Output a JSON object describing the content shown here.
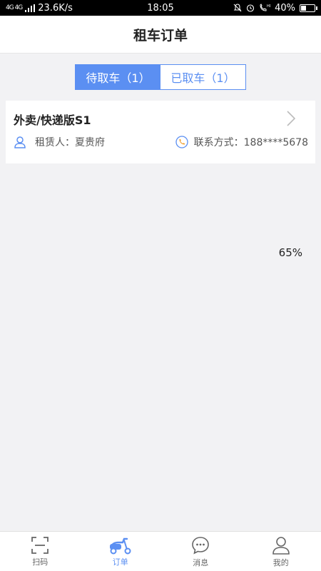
{
  "status_bar": {
    "network": "4G 4G",
    "speed": "23.6K/s",
    "time": "18:05",
    "battery": "40%",
    "battery_level": 0.4
  },
  "header": {
    "title": "租车订单"
  },
  "tabs": [
    {
      "label": "待取车（1）",
      "active": true
    },
    {
      "label": "已取车（1）",
      "active": false
    }
  ],
  "order": {
    "title": "外卖/快递版S1",
    "renter_label": "租赁人：夏贵府",
    "contact_label": "联系方式：188****5678"
  },
  "progress": "65%",
  "nav": [
    {
      "label": "扫码",
      "icon": "scan-icon"
    },
    {
      "label": "订单",
      "icon": "scooter-icon",
      "active": true
    },
    {
      "label": "消息",
      "icon": "message-icon"
    },
    {
      "label": "我的",
      "icon": "user-icon"
    }
  ],
  "colors": {
    "accent": "#5b8ff2",
    "phone_icon": "#f0a030"
  }
}
